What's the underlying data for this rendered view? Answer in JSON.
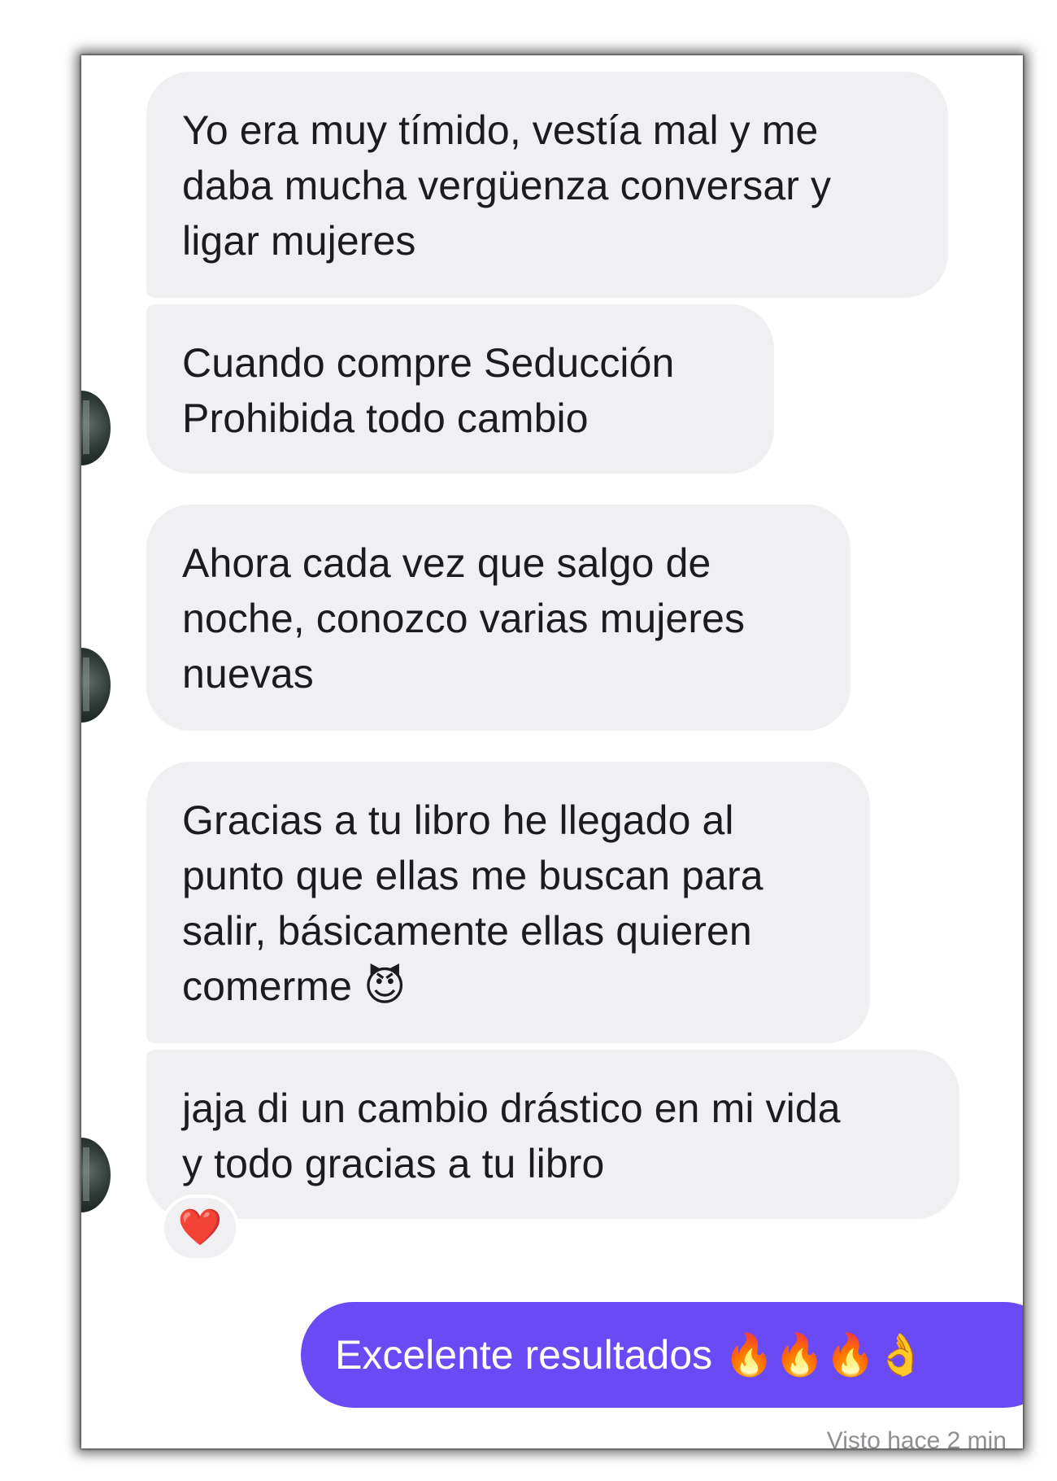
{
  "conversation": {
    "received_messages": [
      {
        "text": "Yo era muy tímido, vestía mal y me\ndaba mucha vergüenza conversar y\nligar mujeres"
      },
      {
        "text": "Cuando compre Seducción\nProhibida todo cambio"
      },
      {
        "text": "Ahora cada vez que salgo de\nnoche, conozco varias mujeres\nnuevas"
      },
      {
        "text": "Gracias a tu libro he llegado al\npunto que ellas me buscan para\nsalir, básicamente ellas quieren\ncomerme 😈"
      },
      {
        "text": "jaja di un cambio drástico en mi vida\ny todo gracias a tu libro"
      }
    ],
    "reaction": {
      "emoji": "❤️",
      "icon": "heart-reaction-icon"
    },
    "sent_message": {
      "text": "Excelente resultados 🔥🔥🔥👌"
    },
    "seen_status": "Visto hace 2 min"
  },
  "colors": {
    "received_bubble": "#f0f0f2",
    "sent_bubble": "#6a4af5",
    "text_dark": "#1c1c1e",
    "text_light": "#ffffff"
  }
}
